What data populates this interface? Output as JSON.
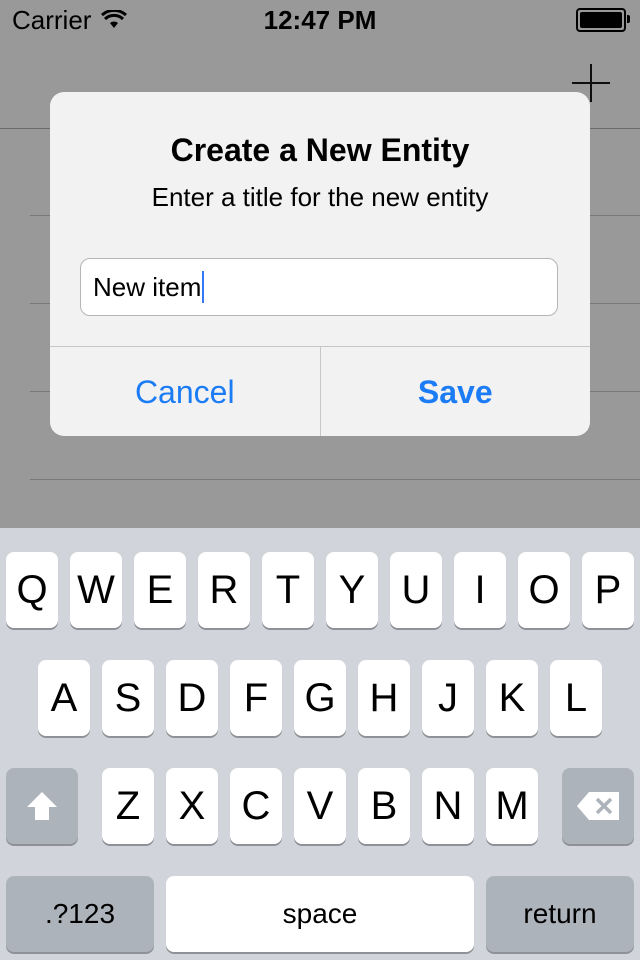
{
  "status_bar": {
    "carrier": "Carrier",
    "time": "12:47 PM"
  },
  "alert": {
    "title": "Create a New Entity",
    "message": "Enter a title for the new entity",
    "input_value": "New item",
    "cancel_label": "Cancel",
    "save_label": "Save"
  },
  "keyboard": {
    "row1": [
      "Q",
      "W",
      "E",
      "R",
      "T",
      "Y",
      "U",
      "I",
      "O",
      "P"
    ],
    "row2": [
      "A",
      "S",
      "D",
      "F",
      "G",
      "H",
      "J",
      "K",
      "L"
    ],
    "row3": [
      "Z",
      "X",
      "C",
      "V",
      "B",
      "N",
      "M"
    ],
    "numbers_label": ".?123",
    "space_label": "space",
    "return_label": "return"
  },
  "colors": {
    "accent": "#1b7cf5",
    "keyboard_bg": "#d1d5db",
    "dark_key": "#adb3bb"
  },
  "icons": [
    "wifi-icon",
    "battery-icon",
    "plus-icon",
    "shift-icon",
    "delete-icon"
  ]
}
